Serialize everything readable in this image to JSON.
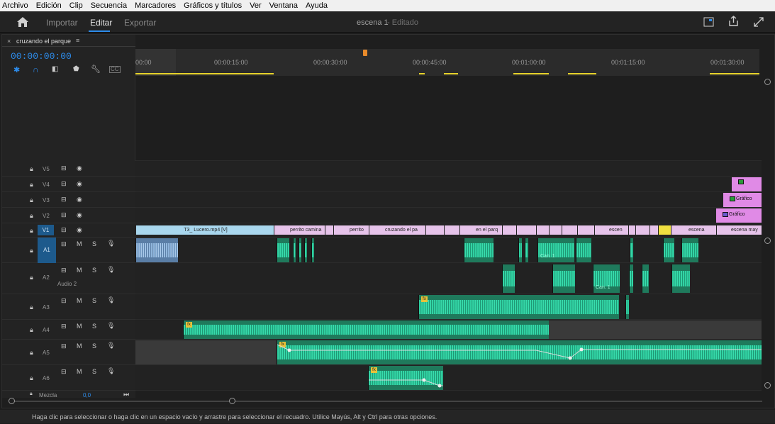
{
  "menu": [
    "Archivo",
    "Edición",
    "Clip",
    "Secuencia",
    "Marcadores",
    "Gráficos y títulos",
    "Ver",
    "Ventana",
    "Ayuda"
  ],
  "topbar": {
    "importar": "Importar",
    "editar": "Editar",
    "exportar": "Exportar",
    "project_title": "escena 1",
    "project_status": "- Editado"
  },
  "panel": {
    "sequence_tab": "cruzando el parque",
    "timecode": "00:00:00:00"
  },
  "ruler": {
    "labels": [
      "00:00",
      "00:00:15:00",
      "00:00:30:00",
      "00:00:45:00",
      "00:01:00:00",
      "00:01:15:00",
      "00:01:30:00"
    ]
  },
  "tracks": {
    "video": [
      "V5",
      "V4",
      "V3",
      "V2",
      "V1"
    ],
    "audio": [
      "A1",
      "A2",
      "A3",
      "A4",
      "A5",
      "A6"
    ],
    "audio2_name": "Audio 2",
    "mute": "M",
    "solo": "S"
  },
  "clips": {
    "v1_main": "T3_ Lucero.mp4 [V]",
    "v1_perrito_camina": "perrito camina",
    "v1_perrito": "perrito",
    "v1_cruzando": "cruzando el pa",
    "v1_en_el_parq": "en el parq",
    "v1_escen": "escen",
    "v1_escena": "escena",
    "v1_escena_may": "escena may",
    "grafico1": "Gráfico",
    "grafico2": "Gráfico",
    "can1": "Can. 1",
    "can2": "Can. 1"
  },
  "mezcla": {
    "label": "Mezcla",
    "value": "0,0"
  },
  "status": "Haga clic para seleccionar o haga clic en un espacio vacío y arrastre para seleccionar el recuadro. Utilice Mayús, Alt y Ctrl para otras opciones."
}
